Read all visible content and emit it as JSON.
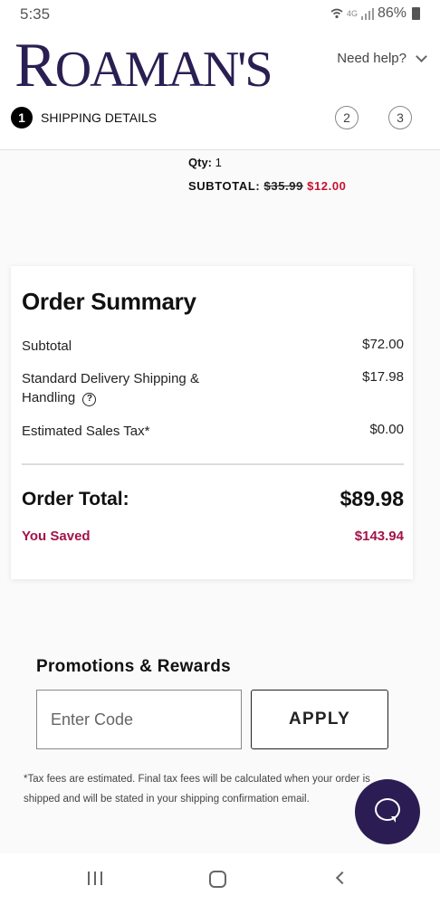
{
  "status": {
    "time": "5:35",
    "network": "4G",
    "battery": "86%"
  },
  "header": {
    "brand": "Roaman's",
    "help_label": "Need help?",
    "steps": [
      {
        "number": "1",
        "label": "SHIPPING DETAILS"
      },
      {
        "number": "2"
      },
      {
        "number": "3"
      }
    ]
  },
  "item": {
    "qty_label": "Qty:",
    "qty_value": "1",
    "subtotal_label": "SUBTOTAL:",
    "original_price": "$35.99",
    "sale_price": "$12.00"
  },
  "order_summary": {
    "title": "Order Summary",
    "rows": [
      {
        "label": "Subtotal",
        "value": "$72.00"
      },
      {
        "label": "Standard Delivery Shipping & Handling",
        "value": "$17.98"
      },
      {
        "label": "Estimated Sales Tax*",
        "value": "$0.00"
      }
    ],
    "total_label": "Order Total:",
    "total_value": "$89.98",
    "saved_label": "You Saved",
    "saved_value": "$143.94"
  },
  "promotions": {
    "title": "Promotions & Rewards",
    "placeholder": "Enter Code",
    "apply_label": "APPLY"
  },
  "note": "*Tax fees are estimated. Final tax fees will be calculated when your order is shipped and will be stated in your shipping confirmation email.",
  "colors": {
    "brand": "#2a1f52",
    "sale": "#c8102e",
    "saved": "#a4124a",
    "chat": "#2b1d54"
  },
  "icons": [
    "wifi-icon",
    "signal-icon",
    "battery-icon",
    "chevron-down-icon",
    "help-circle-icon",
    "chat-icon",
    "recent-apps-icon",
    "home-icon",
    "back-icon"
  ]
}
